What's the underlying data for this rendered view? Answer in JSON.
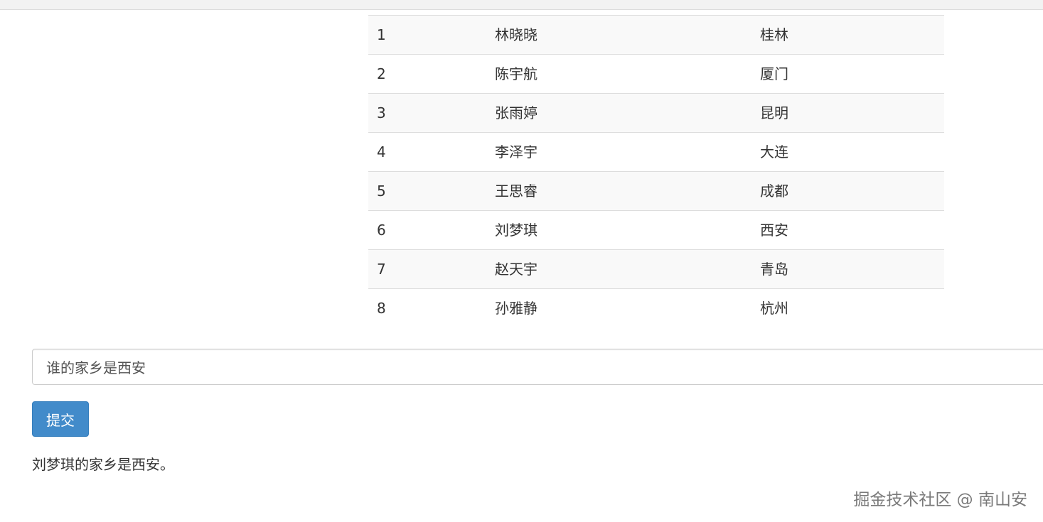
{
  "table": {
    "rows": [
      {
        "id": "1",
        "name": "林晓晓",
        "city": "桂林"
      },
      {
        "id": "2",
        "name": "陈宇航",
        "city": "厦门"
      },
      {
        "id": "3",
        "name": "张雨婷",
        "city": "昆明"
      },
      {
        "id": "4",
        "name": "李泽宇",
        "city": "大连"
      },
      {
        "id": "5",
        "name": "王思睿",
        "city": "成都"
      },
      {
        "id": "6",
        "name": "刘梦琪",
        "city": "西安"
      },
      {
        "id": "7",
        "name": "赵天宇",
        "city": "青岛"
      },
      {
        "id": "8",
        "name": "孙雅静",
        "city": "杭州"
      }
    ]
  },
  "form": {
    "question_value": "谁的家乡是西安",
    "submit_label": "提交"
  },
  "answer": {
    "text": "刘梦琪的家乡是西安。"
  },
  "watermark": {
    "text": "掘金技术社区 @ 南山安"
  },
  "colors": {
    "primary_button": "#428bca",
    "row_stripe": "#f9f9f9",
    "border": "#dddddd"
  }
}
